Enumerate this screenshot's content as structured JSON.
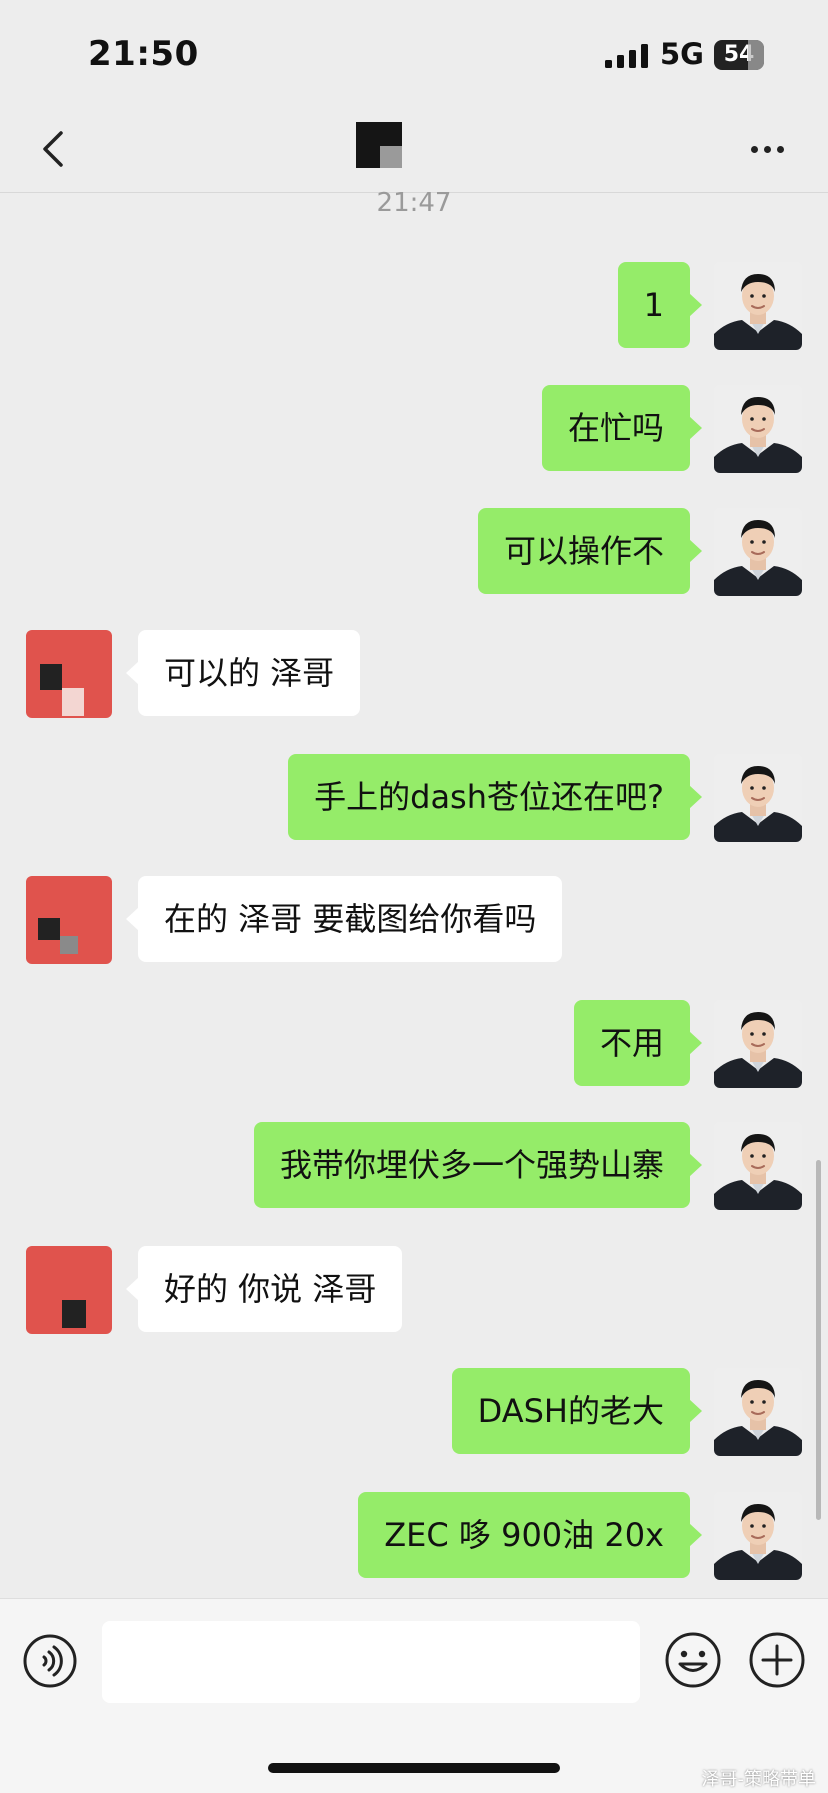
{
  "status_bar": {
    "time": "21:50",
    "network": "5G",
    "battery": "54"
  },
  "nav": {
    "back_icon": "chevron-left-icon",
    "more_icon": "more-dots-icon"
  },
  "chat": {
    "timestamp": "21:47",
    "messages": [
      {
        "side": "me",
        "text": "1"
      },
      {
        "side": "me",
        "text": "在忙吗"
      },
      {
        "side": "me",
        "text": "可以操作不"
      },
      {
        "side": "other",
        "text": "可以的 泽哥"
      },
      {
        "side": "me",
        "text": "手上的dash苍位还在吧?"
      },
      {
        "side": "other",
        "text": "在的 泽哥 要截图给你看吗"
      },
      {
        "side": "me",
        "text": "不用"
      },
      {
        "side": "me",
        "text": "我带你埋伏多一个强势山寨"
      },
      {
        "side": "other",
        "text": "好的 你说 泽哥"
      },
      {
        "side": "me",
        "text": "DASH的老大"
      },
      {
        "side": "me",
        "text": "ZEC 哆 900油 20x"
      }
    ]
  },
  "input_bar": {
    "placeholder": "",
    "voice_icon": "voice-icon",
    "emoji_icon": "emoji-icon",
    "plus_icon": "plus-icon"
  },
  "watermark": "泽哥-策略带单",
  "colors": {
    "me_bubble": "#95ec69",
    "other_bubble": "#ffffff",
    "background": "#ededed"
  }
}
